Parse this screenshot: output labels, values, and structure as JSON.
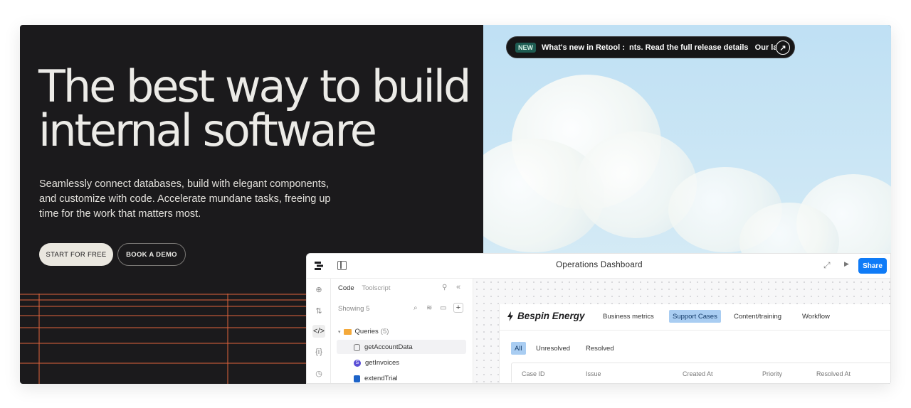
{
  "hero": {
    "title_line1": "The best way to build",
    "title_line2": "internal software",
    "subtitle": "Seamlessly connect databases, build with elegant components, and customize with code. Accelerate mundane tasks, freeing up time for the work that matters most.",
    "cta_primary": "START FOR FREE",
    "cta_secondary": "BOOK A DEMO"
  },
  "announcement": {
    "badge": "NEW",
    "text": "What's new in Retool :  nts. Read the full release details   Our lates",
    "icon": "arrow-up-right-icon"
  },
  "colors": {
    "hero_bg": "#1b1a1c",
    "grid_line": "#e0643c",
    "share_button": "#0f7bf7",
    "active_tab": "#a9cdf2"
  },
  "dashboard": {
    "title": "Operations Dashboard",
    "share_label": "Share",
    "code_panel": {
      "tab_code": "Code",
      "tab_toolscript": "Toolscript",
      "showing": "Showing 5",
      "queries_label": "Queries",
      "queries_count": "(5)",
      "items": [
        "getAccountData",
        "getInvoices",
        "extendTrial"
      ]
    },
    "app": {
      "brand": "Bespin Energy",
      "nav": [
        "Business metrics",
        "Support Cases",
        "Content/training",
        "Workflow"
      ],
      "active_nav": "Support Cases",
      "filters": [
        "All",
        "Unresolved",
        "Resolved"
      ],
      "active_filter": "All",
      "columns": [
        "Case ID",
        "Issue",
        "Created At",
        "Priority",
        "Resolved At"
      ]
    }
  }
}
